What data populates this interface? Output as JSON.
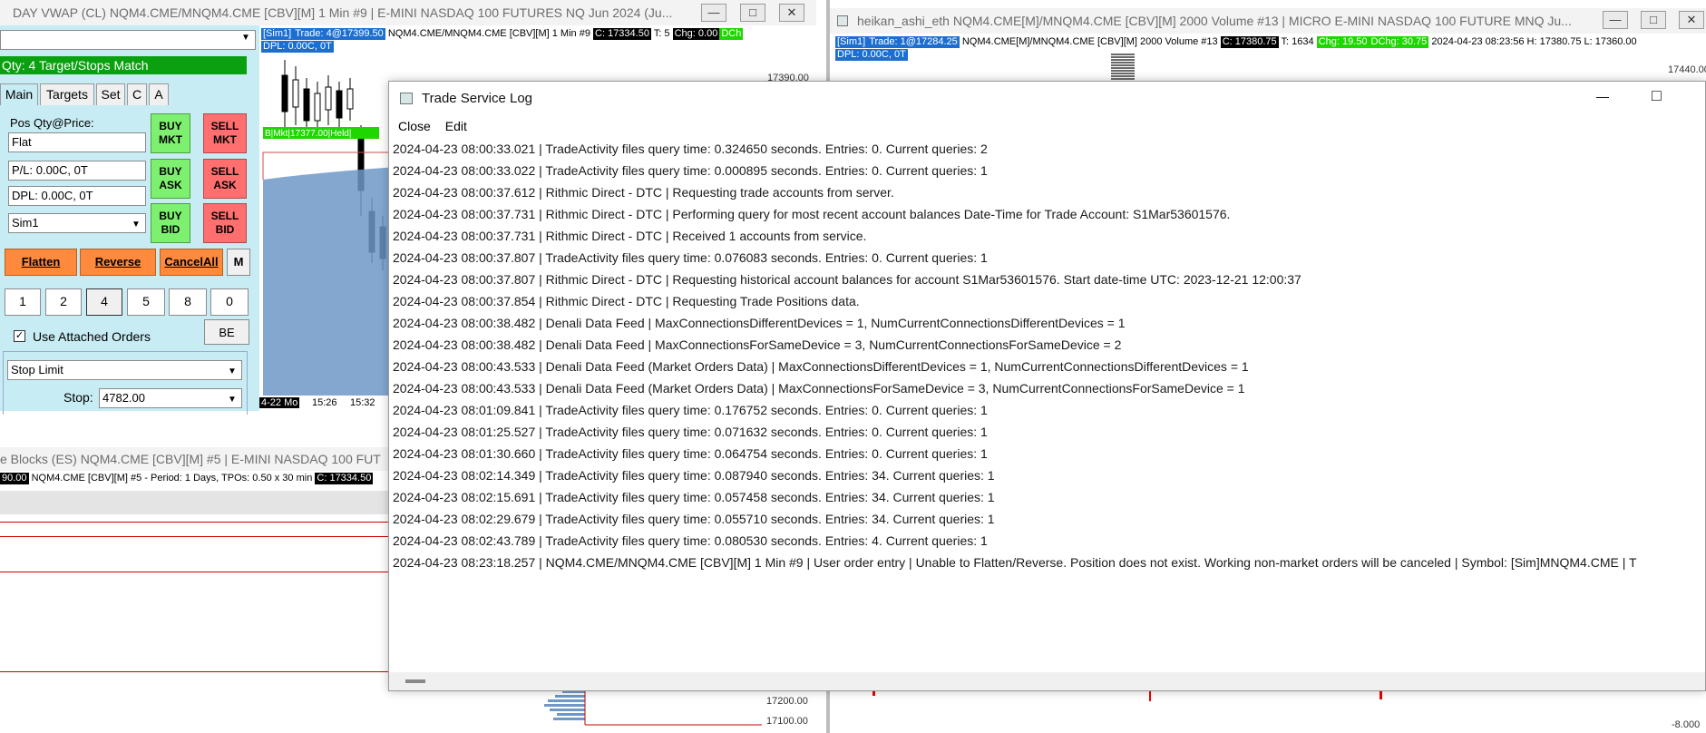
{
  "left_chart": {
    "title": "DAY VWAP (CL) NQM4.CME/MNQM4.CME [CBV][M]  1 Min  #9 | E-MINI NASDAQ 100 FUTURES NQ Jun 2024 (Ju...",
    "info_sim": "[Sim1]",
    "info_trade": "Trade: 4@17399.50",
    "info_symbol": "NQM4.CME/MNQM4.CME [CBV][M]  1 Min  #9",
    "info_c": "C: 17334.50",
    "info_t": "T: 5",
    "info_chg": "Chg: 0.00",
    "info_dch": "DCh",
    "dpl": "DPL: 0.00C, 0T",
    "order_label": "B|Mkt|17377.00|Held|",
    "price_top": "17390.00",
    "date_tick": "4-22 Mo",
    "time_tick_1": "15:26",
    "time_tick_2": "15:32"
  },
  "trade_panel": {
    "qty_status": "Qty: 4 Target/Stops Match",
    "tabs": [
      "Main",
      "Targets",
      "Set",
      "C",
      "A"
    ],
    "pos_label": "Pos Qty@Price:",
    "pos_value": "Flat",
    "pl_value": "P/L: 0.00C, 0T",
    "dpl_value": "DPL: 0.00C, 0T",
    "account": "Sim1",
    "buy_mkt": [
      "BUY",
      "MKT"
    ],
    "sell_mkt": [
      "SELL",
      "MKT"
    ],
    "buy_ask": [
      "BUY",
      "ASK"
    ],
    "sell_ask": [
      "SELL",
      "ASK"
    ],
    "buy_bid": [
      "BUY",
      "BID"
    ],
    "sell_bid": [
      "SELL",
      "BID"
    ],
    "flatten": "Flatten",
    "reverse": "Reverse",
    "cancel_all": "CancelAll",
    "m": "M",
    "quantities": [
      "1",
      "2",
      "4",
      "5",
      "8",
      "0"
    ],
    "selected_quantity": "4",
    "use_attached": "Use Attached Orders",
    "use_attached_checked": true,
    "be": "BE",
    "order_type": "Stop Limit",
    "stop_label": "Stop:",
    "stop_value": "4782.00"
  },
  "right_chart": {
    "title": "heikan_ashi_eth NQM4.CME[M]/MNQM4.CME [CBV][M]  2000 Volume #13 | MICRO E-MINI NASDAQ 100 FUTURE MNQ Ju...",
    "info_sim": "[Sim1]",
    "info_trade": "Trade: 1@17284.25",
    "info_symbol": "NQM4.CME[M]/MNQM4.CME [CBV][M]  2000 Volume #13",
    "info_c": "C: 17380.75",
    "info_t": "T: 1634",
    "info_chg": "Chg: 19.50",
    "info_dchg": "DChg: 30.75",
    "info_rest": "2024-04-23  08:23:56  H: 17380.75  L: 17360.00",
    "dpl": "DPL: 0.00C, 0T",
    "price_top": "17440.00",
    "price_bottom": "-8.000"
  },
  "bottom_chart": {
    "title": "e Blocks (ES) NQM4.CME [CBV][M] #5 | E-MINI NASDAQ 100 FUT",
    "info_price": "90.00",
    "info_symbol": "NQM4.CME [CBV][M] #5 - Period: 1 Days, TPOs: 0.50 x 30 min",
    "info_c": "C: 17334.50",
    "price_1": "17200.00",
    "price_2": "17100.00"
  },
  "log_window": {
    "title": "Trade Service Log",
    "menu": [
      "Close",
      "Edit"
    ],
    "lines": [
      "2024-04-23  08:00:33.021 | TradeActivity files query time: 0.324650 seconds. Entries: 0. Current queries: 2",
      "2024-04-23  08:00:33.022 | TradeActivity files query time: 0.000895 seconds. Entries: 0. Current queries: 1",
      "2024-04-23  08:00:37.612 | Rithmic Direct - DTC | Requesting trade accounts from server.",
      "2024-04-23  08:00:37.731 | Rithmic Direct - DTC | Performing query for most recent account balances Date-Time for Trade Account: S1Mar53601576.",
      "2024-04-23  08:00:37.731 | Rithmic Direct - DTC | Received 1 accounts from service.",
      "2024-04-23  08:00:37.807 | TradeActivity files query time: 0.076083 seconds. Entries: 0. Current queries: 1",
      "2024-04-23  08:00:37.807 | Rithmic Direct - DTC | Requesting historical account balances for account S1Mar53601576. Start date-time UTC: 2023-12-21  12:00:37",
      "2024-04-23  08:00:37.854 | Rithmic Direct - DTC | Requesting Trade Positions data.",
      "2024-04-23  08:00:38.482 | Denali Data Feed | MaxConnectionsDifferentDevices = 1, NumCurrentConnectionsDifferentDevices = 1",
      "2024-04-23  08:00:38.482 | Denali Data Feed | MaxConnectionsForSameDevice = 3, NumCurrentConnectionsForSameDevice = 2",
      "2024-04-23  08:00:43.533 | Denali Data Feed (Market Orders Data) | MaxConnectionsDifferentDevices = 1, NumCurrentConnectionsDifferentDevices = 1",
      "2024-04-23  08:00:43.533 | Denali Data Feed (Market Orders Data) | MaxConnectionsForSameDevice = 3, NumCurrentConnectionsForSameDevice = 1",
      "2024-04-23  08:01:09.841 | TradeActivity files query time: 0.176752 seconds. Entries: 0. Current queries: 1",
      "2024-04-23  08:01:25.527 | TradeActivity files query time: 0.071632 seconds. Entries: 0. Current queries: 1",
      "2024-04-23  08:01:30.660 | TradeActivity files query time: 0.064754 seconds. Entries: 0. Current queries: 1",
      "2024-04-23  08:02:14.349 | TradeActivity files query time: 0.087940 seconds. Entries: 34. Current queries: 1",
      "2024-04-23  08:02:15.691 | TradeActivity files query time: 0.057458 seconds. Entries: 34. Current queries: 1",
      "2024-04-23  08:02:29.679 | TradeActivity files query time: 0.055710 seconds. Entries: 34. Current queries: 1",
      "2024-04-23  08:02:43.789 | TradeActivity files query time: 0.080530 seconds. Entries: 4. Current queries: 1",
      "2024-04-23  08:23:18.257 | NQM4.CME/MNQM4.CME [CBV][M]  1 Min  #9 | User order entry | Unable to Flatten/Reverse. Position does not exist. Working non-market orders will be canceled | Symbol: [Sim]MNQM4.CME | T"
    ]
  },
  "colors": {
    "status_green": "#0aa010",
    "buy_green": "#7ef06f",
    "sell_red": "#ff6f6f",
    "action_orange": "#ff8a3d",
    "chart_fill": "#6f98c8",
    "panel_bg": "#c7ecf3"
  }
}
